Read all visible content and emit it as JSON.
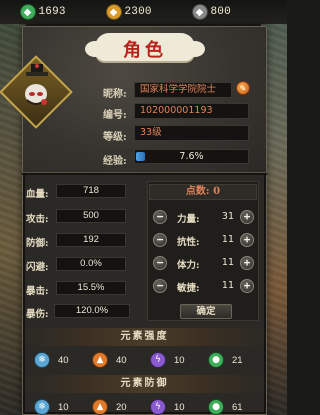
{
  "resources": [
    {
      "icon": "jade-icon",
      "value": "1693",
      "color": "#3fae5a"
    },
    {
      "icon": "gold-coin-icon",
      "value": "2300",
      "color": "#d99a2a"
    },
    {
      "icon": "silver-coin-icon",
      "value": "800",
      "color": "#8a8a8a"
    }
  ],
  "panel": {
    "title": "角色"
  },
  "profile": {
    "nickname_label": "昵称:",
    "nickname": "国家科学学院院士",
    "id_label": "编号:",
    "id": "102000001193",
    "rank_label": "等级:",
    "rank": "33级",
    "exp_label": "经验:",
    "exp_text": "7.6%",
    "exp_fraction": 0.076
  },
  "stats": [
    {
      "label": "血量:",
      "value": "718"
    },
    {
      "label": "攻击:",
      "value": "500"
    },
    {
      "label": "防御:",
      "value": "192"
    },
    {
      "label": "闪避:",
      "value": "0.0%"
    },
    {
      "label": "暴击:",
      "value": "15.5%"
    },
    {
      "label": "暴伤:",
      "value": "120.0%"
    }
  ],
  "points": {
    "header": "点数: 0",
    "items": [
      {
        "label": "力量:",
        "value": "31"
      },
      {
        "label": "抗性:",
        "value": "11"
      },
      {
        "label": "体力:",
        "value": "11"
      },
      {
        "label": "敏捷:",
        "value": "11"
      }
    ],
    "confirm": "确定"
  },
  "element_strength": {
    "title": "元素强度",
    "items": [
      {
        "icon": "ice-icon",
        "value": "40",
        "color": "#5aa7d6"
      },
      {
        "icon": "fire-icon",
        "value": "40",
        "color": "#e07a2a"
      },
      {
        "icon": "lightning-icon",
        "value": "10",
        "color": "#8a5ad0"
      },
      {
        "icon": "poison-icon",
        "value": "21",
        "color": "#3fae5a"
      }
    ]
  },
  "element_defense": {
    "title": "元素防御",
    "items": [
      {
        "icon": "ice-icon",
        "value": "10",
        "color": "#5aa7d6"
      },
      {
        "icon": "fire-icon",
        "value": "20",
        "color": "#e07a2a"
      },
      {
        "icon": "lightning-icon",
        "value": "10",
        "color": "#8a5ad0"
      },
      {
        "icon": "poison-icon",
        "value": "61",
        "color": "#3fae5a"
      }
    ]
  }
}
